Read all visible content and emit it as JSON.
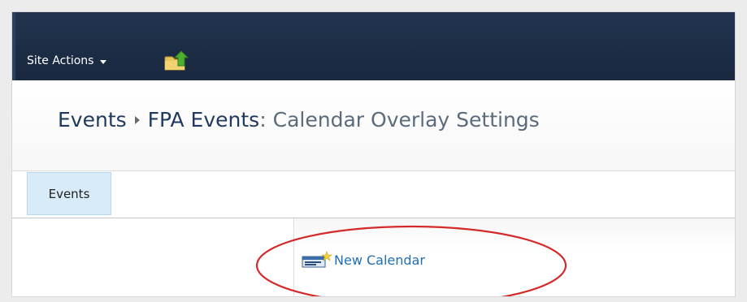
{
  "ribbon": {
    "site_actions_label": "Site Actions"
  },
  "breadcrumb": {
    "level1": "Events",
    "level2": "FPA Events",
    "separator_colon": ":",
    "current": "Calendar Overlay Settings"
  },
  "tabs": [
    {
      "label": "Events",
      "selected": true
    }
  ],
  "actions": {
    "new_calendar_label": "New Calendar"
  },
  "icons": {
    "navigate_up": "folder-up-arrow-icon",
    "new_calendar": "new-calendar-icon",
    "dropdown": "chevron-down-icon",
    "breadcrumb_separator": "breadcrumb-arrow-icon"
  },
  "colors": {
    "ribbon_bg": "#1c2c45",
    "title_text": "#1f3a5e",
    "tab_selected_bg": "#d7ebf9",
    "link_blue": "#1f6fb2",
    "annotation_red": "#d42a2a"
  }
}
